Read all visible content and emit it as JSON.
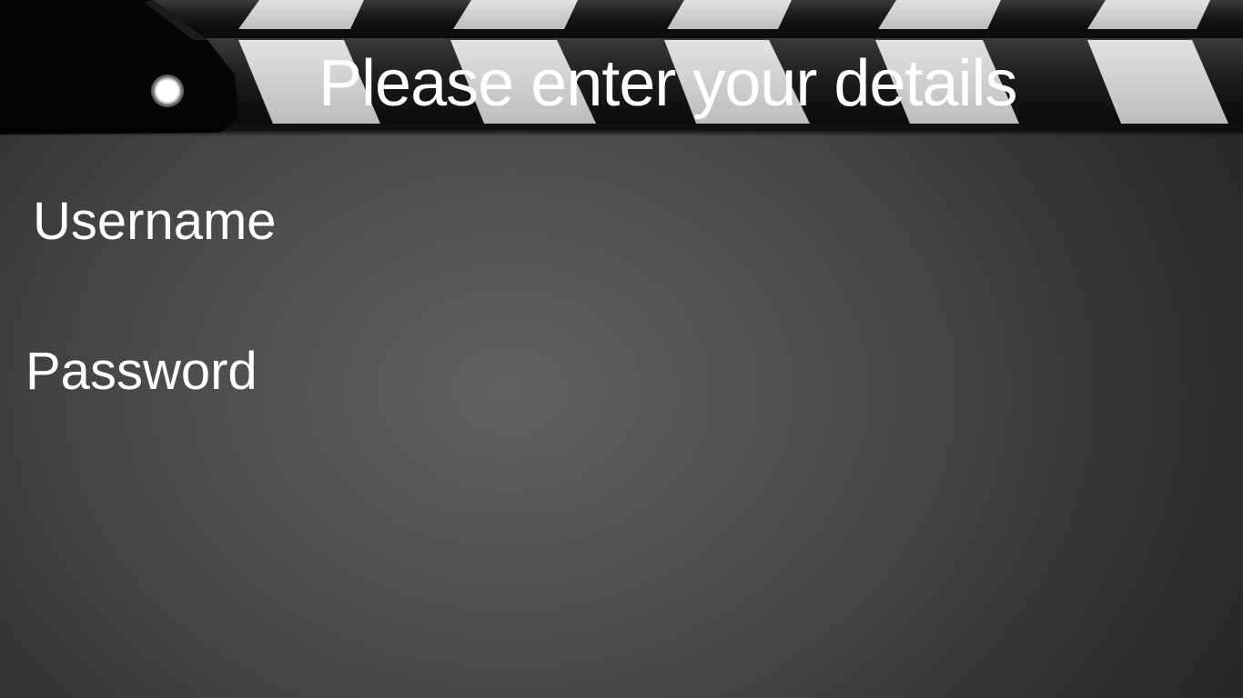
{
  "header": {
    "title": "Please enter your details"
  },
  "form": {
    "username_label": "Username",
    "password_label": "Password"
  },
  "colors": {
    "text": "#ffffff",
    "stripe_light": "#d6d6d6",
    "stripe_dark": "#1e1e1e",
    "clapper_black": "#050505"
  }
}
